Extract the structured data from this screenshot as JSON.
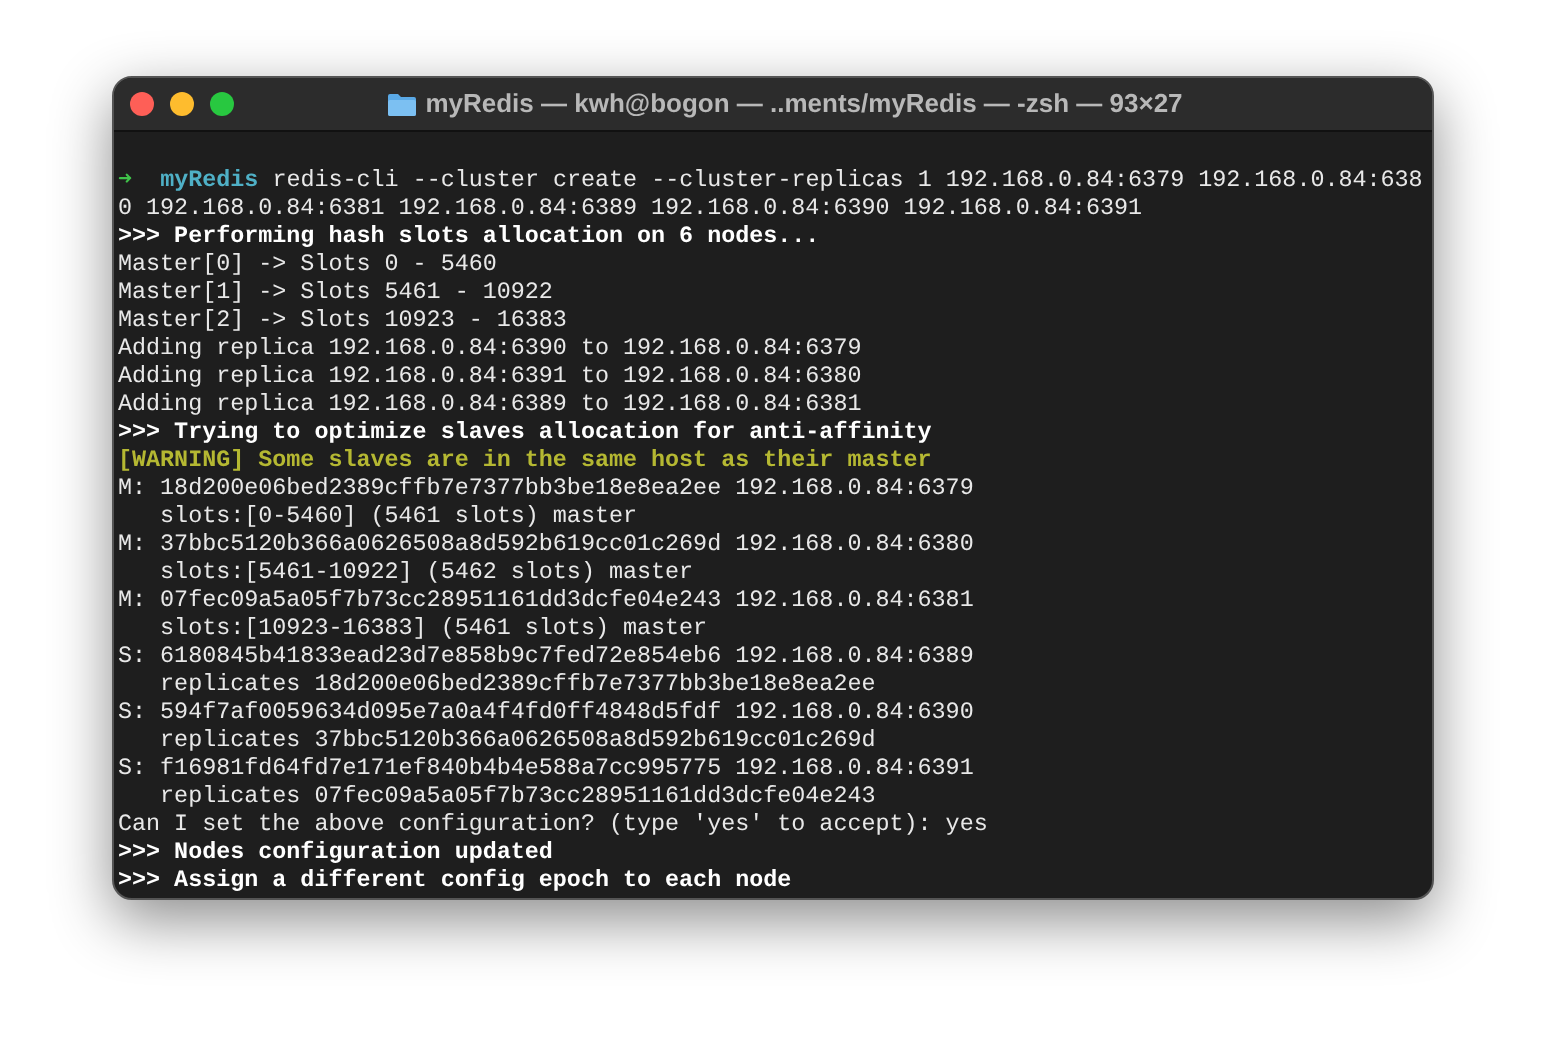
{
  "window": {
    "title": "myRedis — kwh@bogon — ..ments/myRedis — -zsh — 93×27"
  },
  "lines": [
    {
      "kind": "prompt",
      "arrow": "➜",
      "directory": "myRedis",
      "text": "redis-cli --cluster create --cluster-replicas 1 192.168.0.84:6379 192.168.0.84:638"
    },
    {
      "kind": "plain",
      "text": "0 192.168.0.84:6381 192.168.0.84:6389 192.168.0.84:6390 192.168.0.84:6391"
    },
    {
      "kind": "bold",
      "text": ">>> Performing hash slots allocation on 6 nodes..."
    },
    {
      "kind": "plain",
      "text": "Master[0] -> Slots 0 - 5460"
    },
    {
      "kind": "plain",
      "text": "Master[1] -> Slots 5461 - 10922"
    },
    {
      "kind": "plain",
      "text": "Master[2] -> Slots 10923 - 16383"
    },
    {
      "kind": "plain",
      "text": "Adding replica 192.168.0.84:6390 to 192.168.0.84:6379"
    },
    {
      "kind": "plain",
      "text": "Adding replica 192.168.0.84:6391 to 192.168.0.84:6380"
    },
    {
      "kind": "plain",
      "text": "Adding replica 192.168.0.84:6389 to 192.168.0.84:6381"
    },
    {
      "kind": "bold",
      "text": ">>> Trying to optimize slaves allocation for anti-affinity"
    },
    {
      "kind": "warning",
      "text": "[WARNING] Some slaves are in the same host as their master"
    },
    {
      "kind": "plain",
      "text": "M: 18d200e06bed2389cffb7e7377bb3be18e8ea2ee 192.168.0.84:6379"
    },
    {
      "kind": "plain",
      "text": "   slots:[0-5460] (5461 slots) master"
    },
    {
      "kind": "plain",
      "text": "M: 37bbc5120b366a0626508a8d592b619cc01c269d 192.168.0.84:6380"
    },
    {
      "kind": "plain",
      "text": "   slots:[5461-10922] (5462 slots) master"
    },
    {
      "kind": "plain",
      "text": "M: 07fec09a5a05f7b73cc28951161dd3dcfe04e243 192.168.0.84:6381"
    },
    {
      "kind": "plain",
      "text": "   slots:[10923-16383] (5461 slots) master"
    },
    {
      "kind": "plain",
      "text": "S: 6180845b41833ead23d7e858b9c7fed72e854eb6 192.168.0.84:6389"
    },
    {
      "kind": "plain",
      "text": "   replicates 18d200e06bed2389cffb7e7377bb3be18e8ea2ee"
    },
    {
      "kind": "plain",
      "text": "S: 594f7af0059634d095e7a0a4f4fd0ff4848d5fdf 192.168.0.84:6390"
    },
    {
      "kind": "plain",
      "text": "   replicates 37bbc5120b366a0626508a8d592b619cc01c269d"
    },
    {
      "kind": "plain",
      "text": "S: f16981fd64fd7e171ef840b4b4e588a7cc995775 192.168.0.84:6391"
    },
    {
      "kind": "plain",
      "text": "   replicates 07fec09a5a05f7b73cc28951161dd3dcfe04e243"
    },
    {
      "kind": "plain",
      "text": "Can I set the above configuration? (type 'yes' to accept): yes"
    },
    {
      "kind": "bold",
      "text": ">>> Nodes configuration updated"
    },
    {
      "kind": "bold",
      "text": ">>> Assign a different config epoch to each node"
    }
  ]
}
